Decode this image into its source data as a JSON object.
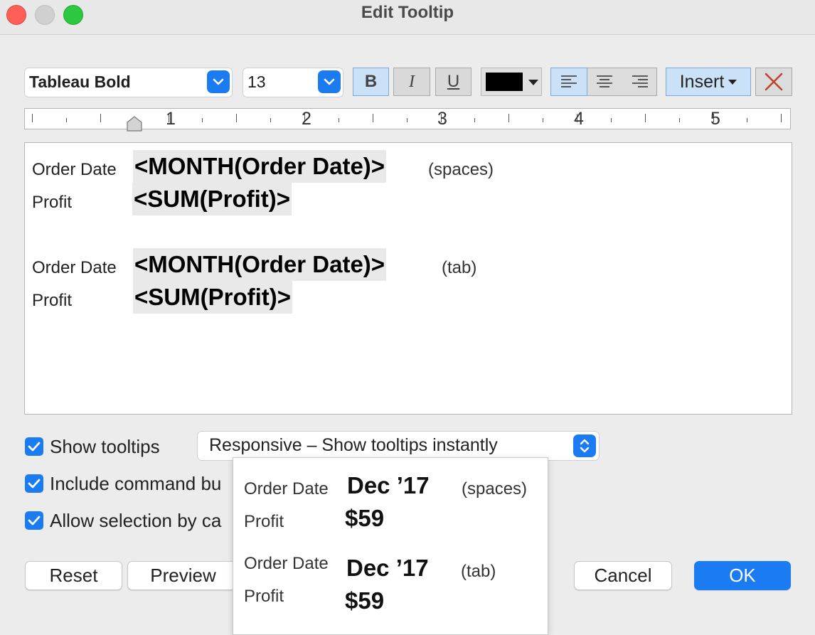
{
  "window": {
    "title": "Edit Tooltip"
  },
  "toolbar": {
    "font_name": "Tableau Bold",
    "font_size": "13",
    "bold_label": "B",
    "italic_label": "I",
    "underline_label": "U",
    "text_color": "#000000",
    "insert_label": "Insert"
  },
  "ruler": {
    "numbers": [
      "1",
      "2",
      "3",
      "4",
      "5"
    ]
  },
  "editor": {
    "row1": {
      "label": "Order Date",
      "field": "<MONTH(Order Date)>",
      "note": "(spaces)"
    },
    "row2": {
      "label": "Profit",
      "field": "<SUM(Profit)>"
    },
    "row3": {
      "label": "Order Date",
      "field": "<MONTH(Order Date)>",
      "note": "(tab)"
    },
    "row4": {
      "label": "Profit",
      "field": "<SUM(Profit)>"
    }
  },
  "options": {
    "show_tooltips": {
      "label": "Show tooltips",
      "checked": true
    },
    "include_command": {
      "label": "Include command bu",
      "checked": true
    },
    "allow_selection": {
      "label": "Allow selection by ca",
      "checked": true
    },
    "tooltip_mode": "Responsive – Show tooltips instantly"
  },
  "preview": {
    "row1": {
      "label": "Order Date",
      "value": "Dec ’17",
      "note": "(spaces)"
    },
    "row2": {
      "label": "Profit",
      "value": "$59"
    },
    "row3": {
      "label": "Order Date",
      "value": "Dec ’17",
      "note": "(tab)"
    },
    "row4": {
      "label": "Profit",
      "value": "$59"
    }
  },
  "buttons": {
    "reset": "Reset",
    "preview": "Preview",
    "cancel": "Cancel",
    "ok": "OK"
  },
  "colors": {
    "accent": "#1a7bf3",
    "close": "#fe5f57",
    "maximize": "#2bc840",
    "clear_x": "#b8452c"
  }
}
